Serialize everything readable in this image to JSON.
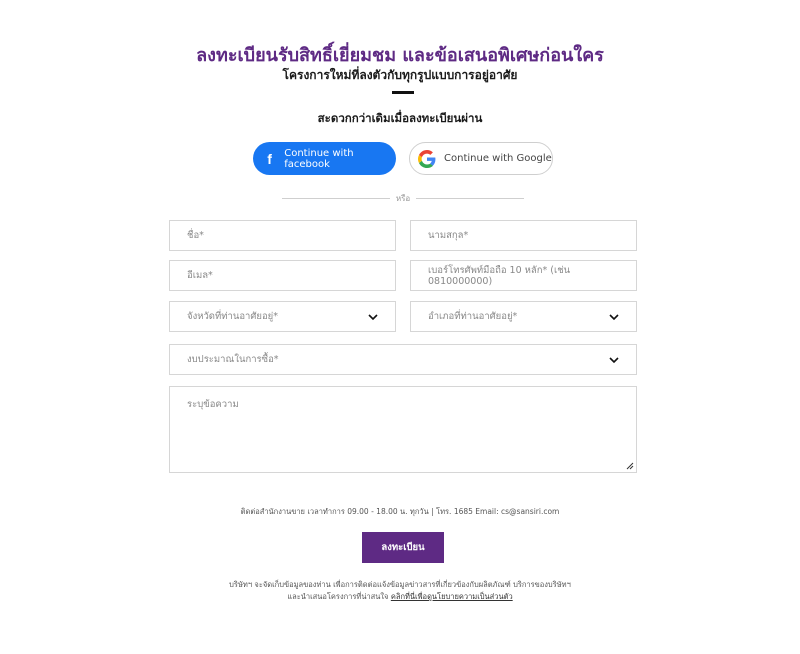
{
  "header": {
    "title": "ลงทะเบียนรับสิทธิ์เยี่ยมชม และข้อเสนอพิเศษก่อนใคร",
    "subtitle": "โครงการใหม่ที่ลงตัวกับทุกรูปแบบการอยู่อาศัย",
    "lead": "สะดวกกว่าเดิมเมื่อลงทะเบียนผ่าน"
  },
  "social": {
    "facebook_label": "Continue with facebook",
    "google_label": "Continue with Google",
    "or_label": "หรือ"
  },
  "form": {
    "first_name_placeholder": "ชื่อ*",
    "last_name_placeholder": "นามสกุล*",
    "email_placeholder": "อีเมล*",
    "phone_placeholder": "เบอร์โทรศัพท์มือถือ 10 หลัก* (เช่น 0810000000)",
    "province_placeholder": "จังหวัดที่ท่านอาศัยอยู่*",
    "district_placeholder": "อำเภอที่ท่านอาศัยอยู่*",
    "budget_placeholder": "งบประมาณในการซื้อ*",
    "message_placeholder": "ระบุข้อความ"
  },
  "contact_text": "ติดต่อสำนักงานขาย เวลาทำการ 09.00 - 18.00 น. ทุกวัน | โทร. 1685 Email: cs@sansiri.com",
  "submit_label": "ลงทะเบียน",
  "disclaimer": {
    "line1": "บริษัทฯ จะจัดเก็บข้อมูลของท่าน เพื่อการติดต่อแจ้งข้อมูลข่าวสารที่เกี่ยวข้องกับผลิตภัณฑ์ บริการของบริษัทฯ",
    "line2_prefix": "และนำเสนอโครงการที่น่าสนใจ ",
    "link": "คลิกที่นี่เพื่อดูนโยบายความเป็นส่วนตัว"
  },
  "colors": {
    "brand_purple": "#5e2a84",
    "facebook_blue": "#1877f2"
  },
  "icons": [
    "facebook-icon",
    "google-icon",
    "chevron-down-icon",
    "resize-handle-icon"
  ]
}
